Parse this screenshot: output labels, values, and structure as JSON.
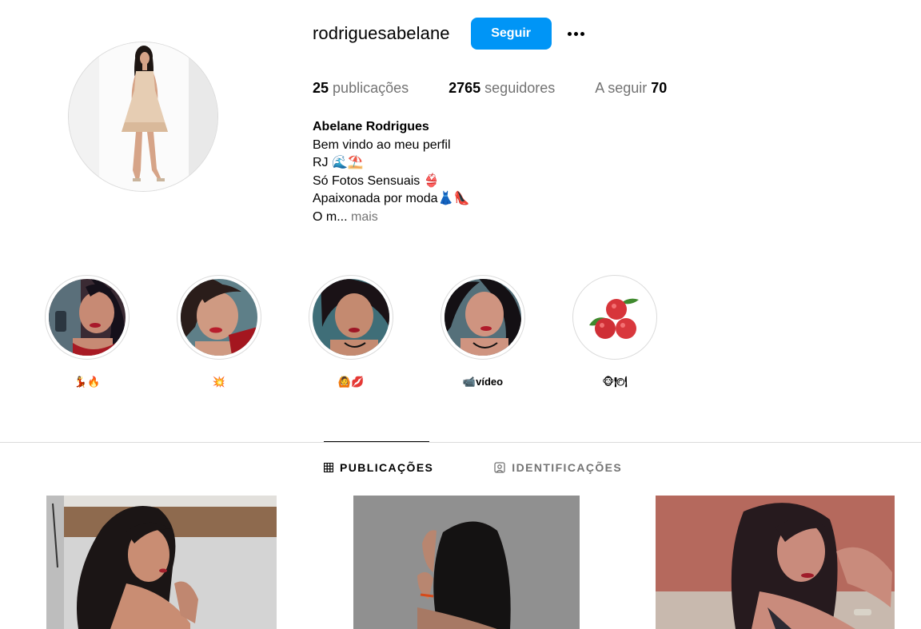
{
  "profile": {
    "username": "rodriguesabelane",
    "follow_label": "Seguir",
    "more_options_icon": "more-horizontal-icon"
  },
  "stats": {
    "posts_count": "25",
    "posts_label": "publicações",
    "followers_count": "2765",
    "followers_label": "seguidores",
    "following_label": "A seguir",
    "following_count": "70"
  },
  "bio": {
    "full_name": "Abelane Rodrigues",
    "lines": [
      "Bem vindo ao meu perfil",
      "RJ 🌊⛱️",
      "Só Fotos Sensuais 👙",
      "Apaixonada por moda👗👠",
      "O m..."
    ],
    "more_label": "mais"
  },
  "highlights": [
    {
      "label": "💃🔥"
    },
    {
      "label": "💥"
    },
    {
      "label": "🙆💋"
    },
    {
      "label": "📹vídeo"
    },
    {
      "label": "🐵🍽"
    }
  ],
  "tabs": [
    {
      "label": "PUBLICAÇÕES",
      "icon": "grid-icon",
      "active": true
    },
    {
      "label": "IDENTIFICAÇÕES",
      "icon": "tagged-user-icon",
      "active": false
    }
  ],
  "colors": {
    "accent": "#0095f6",
    "secondary_text": "#737373",
    "border": "#dbdbdb"
  }
}
